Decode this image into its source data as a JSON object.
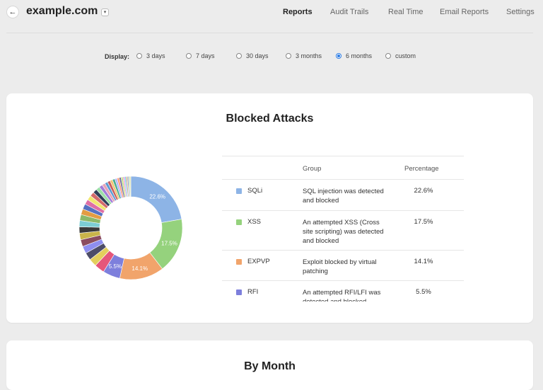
{
  "header": {
    "site_title": "example.com",
    "nav": [
      "Reports",
      "Audit Trails",
      "Real Time",
      "Email Reports",
      "Settings"
    ],
    "active_nav": "Reports"
  },
  "display": {
    "label": "Display:",
    "options": [
      "3 days",
      "7 days",
      "30 days",
      "3 months",
      "6 months",
      "custom"
    ],
    "selected": "6 months"
  },
  "blocked_attacks": {
    "title": "Blocked Attacks",
    "columns": {
      "group": "Group",
      "percentage": "Percentage"
    },
    "rows": [
      {
        "code": "SQLi",
        "description": "SQL injection was detected and blocked",
        "percentage": "22.6%",
        "color": "#8db4e6"
      },
      {
        "code": "XSS",
        "description": "An attempted XSS (Cross site scripting) was detected and blocked",
        "percentage": "17.5%",
        "color": "#95d27d"
      },
      {
        "code": "EXPVP",
        "description": "Exploit blocked by virtual patching",
        "percentage": "14.1%",
        "color": "#f1a46b"
      },
      {
        "code": "RFI",
        "description": "An attempted RFI/LFI was detected and blocked",
        "percentage": "5.5%",
        "color": "#7d7fdc"
      }
    ]
  },
  "chart_data": {
    "type": "pie",
    "labels_on_chart": [
      "22.6%",
      "17.5%",
      "14.1%",
      "5.5%"
    ],
    "values": [
      22.6,
      17.5,
      14.1,
      5.5,
      3.2,
      2.5,
      2.4,
      2.3,
      2.2,
      2.1,
      2.0,
      2.0,
      1.9,
      1.8,
      1.7,
      1.6,
      1.5,
      1.4,
      1.3,
      1.2,
      1.1,
      1.0,
      0.9,
      0.9,
      0.8,
      0.8,
      0.7,
      0.7,
      0.6,
      0.6,
      0.5,
      0.5,
      0.4,
      0.4,
      0.4,
      0.3
    ],
    "colors": [
      "#8db4e6",
      "#95d27d",
      "#f1a46b",
      "#7d7fdc",
      "#e5567a",
      "#e3cf5c",
      "#4d4d68",
      "#8e8ef0",
      "#8b4c60",
      "#c9b44a",
      "#3a3a3a",
      "#7ccdd4",
      "#8cb96a",
      "#e39c43",
      "#5671c2",
      "#de6fa6",
      "#f1e76f",
      "#d36b6b",
      "#2f3f58",
      "#9be0a7",
      "#a27dd8",
      "#e7a2b6",
      "#5a9bd4",
      "#c95c5c",
      "#f0c674",
      "#4caf8e",
      "#b3b3ff",
      "#ff9f7a",
      "#6c6c9c",
      "#c4e17f",
      "#e89fd8",
      "#82c9f0",
      "#d6a96b",
      "#9a9ad0",
      "#b0d89c",
      "#e0e0a0"
    ]
  },
  "by_month": {
    "title": "By Month"
  }
}
